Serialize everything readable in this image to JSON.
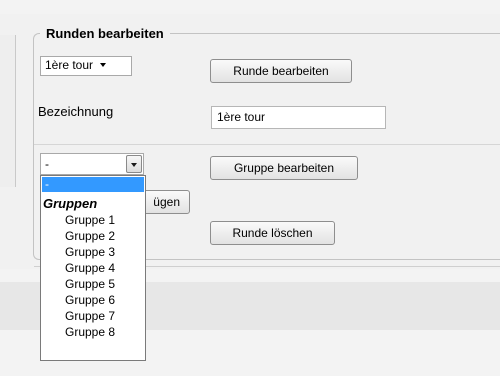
{
  "fieldset": {
    "legend": "Runden bearbeiten"
  },
  "round": {
    "selected": "1ère tour",
    "edit_button": "Runde bearbeiten",
    "name_label": "Bezeichnung",
    "name_value": "1ère tour",
    "delete_button": "Runde löschen"
  },
  "group": {
    "selected": "-",
    "edit_button": "Gruppe bearbeiten",
    "add_button_visible_text": "ügen",
    "dropdown": {
      "selected_option": "-",
      "optgroup_label": "Gruppen",
      "options": [
        "Gruppe 1",
        "Gruppe 2",
        "Gruppe 3",
        "Gruppe 4",
        "Gruppe 5",
        "Gruppe 6",
        "Gruppe 7",
        "Gruppe 8"
      ]
    }
  },
  "colors": {
    "highlight": "#3399ff",
    "panel": "#f1f1f1",
    "border": "#c3c3c3"
  }
}
